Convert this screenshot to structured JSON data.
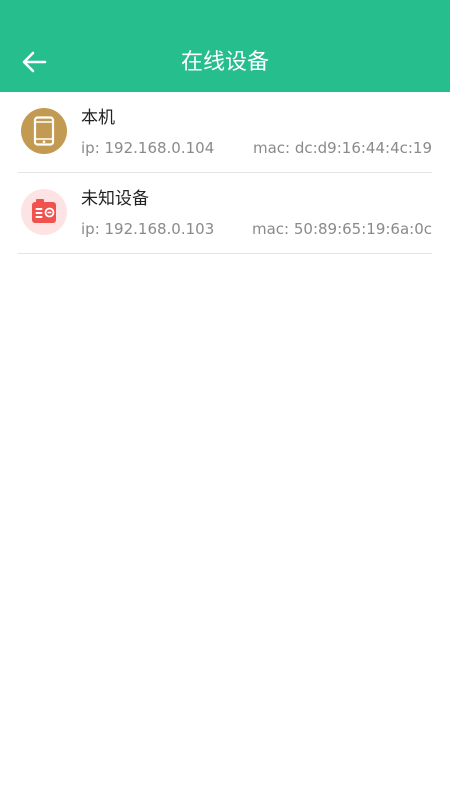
{
  "header": {
    "title": "在线设备",
    "bg_color": "#26be8c"
  },
  "devices": [
    {
      "name": "本机",
      "ip": "ip: 192.168.0.104",
      "mac": "mac: dc:d9:16:44:4c:19",
      "icon": "phone-icon",
      "icon_bg": "#c39a52"
    },
    {
      "name": "未知设备",
      "ip": "ip: 192.168.0.103",
      "mac": "mac: 50:89:65:19:6a:0c",
      "icon": "unknown-device-icon",
      "icon_bg": "#fde3e3"
    }
  ]
}
